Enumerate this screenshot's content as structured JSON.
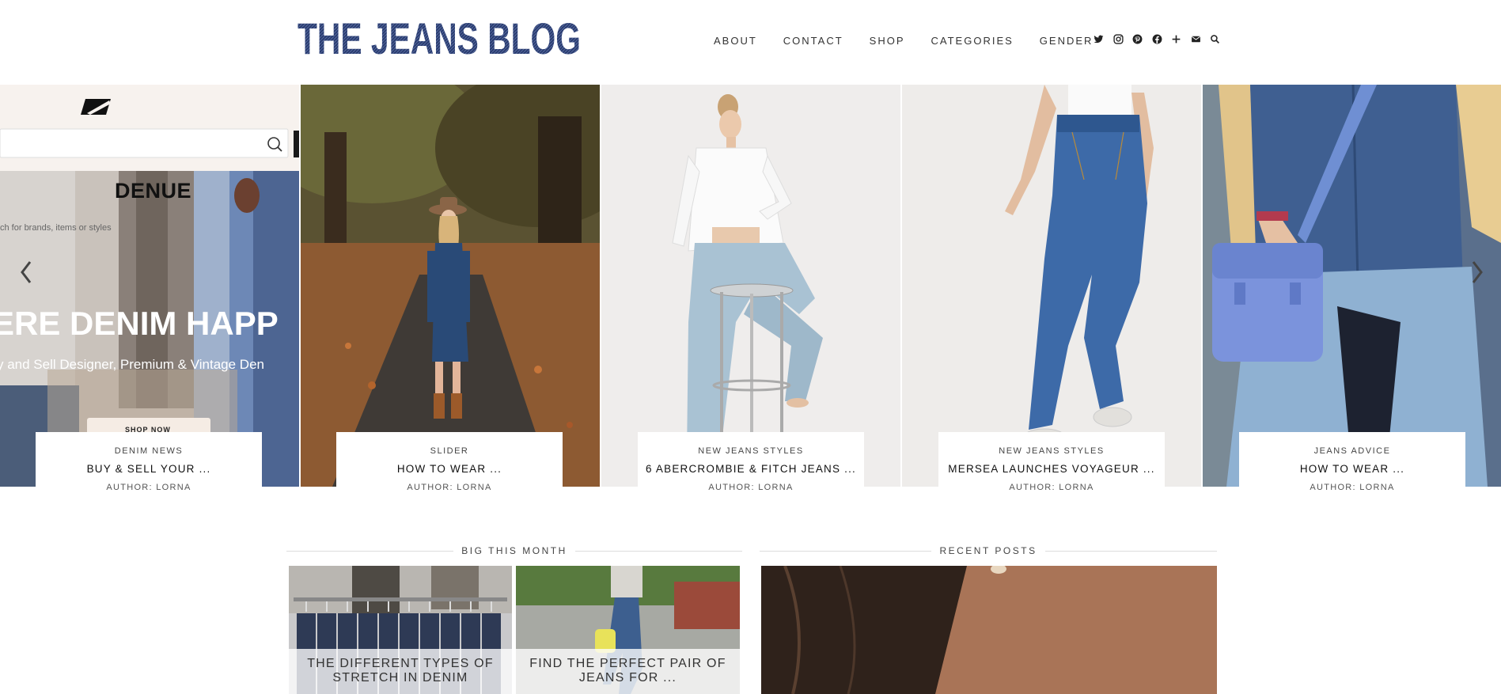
{
  "header": {
    "logo_text": "THE JEANS BLOG",
    "nav": [
      "ABOUT",
      "CONTACT",
      "SHOP",
      "CATEGORIES",
      "GENDER"
    ],
    "social_icons": [
      "twitter-icon",
      "instagram-icon",
      "pinterest-icon",
      "facebook-icon",
      "plus-icon",
      "email-icon",
      "search-icon"
    ]
  },
  "slider": {
    "ad": {
      "brand": "DENUE",
      "search_placeholder": "ch for brands, items or styles",
      "headline": "ERE DENIM HAPP",
      "subline": "y and Sell Designer, Premium & Vintage Den",
      "button": "SHOP NOW"
    },
    "slides": [
      {
        "category": "DENIM NEWS",
        "title": "BUY & SELL YOUR ...",
        "author": "AUTHOR: LORNA"
      },
      {
        "category": "SLIDER",
        "title": "HOW TO WEAR ...",
        "author": "AUTHOR: LORNA"
      },
      {
        "category": "NEW JEANS STYLES",
        "title": "6 ABERCROMBIE & FITCH JEANS ...",
        "author": "AUTHOR: LORNA"
      },
      {
        "category": "NEW JEANS STYLES",
        "title": "MERSEA LAUNCHES VOYAGEUR ...",
        "author": "AUTHOR: LORNA"
      },
      {
        "category": "JEANS ADVICE",
        "title": "HOW TO WEAR ...",
        "author": "AUTHOR: LORNA"
      }
    ]
  },
  "big_this_month": {
    "title": "BIG THIS MONTH",
    "posts": [
      {
        "line1": "THE DIFFERENT TYPES OF",
        "line2": "STRETCH IN DENIM"
      },
      {
        "line1": "FIND THE PERFECT PAIR OF",
        "line2": "JEANS FOR ..."
      }
    ]
  },
  "recent_posts": {
    "title": "RECENT POSTS"
  },
  "colors": {
    "logo_blue": "#2a3a6b",
    "accent_text": "#333333"
  }
}
